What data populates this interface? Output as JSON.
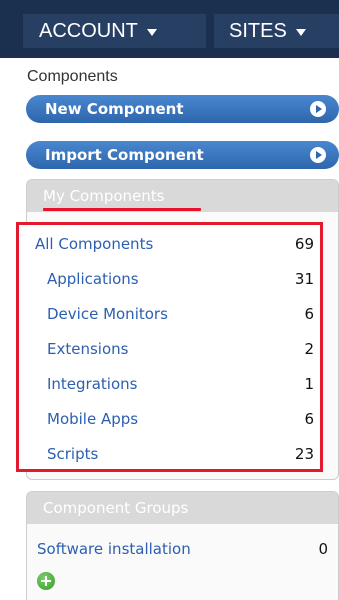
{
  "nav": {
    "account": "ACCOUNT",
    "sites": "SITES"
  },
  "components": {
    "section_title": "Components",
    "new_button": "New Component",
    "import_button": "Import Component"
  },
  "my_components": {
    "header": "My Components",
    "items": [
      {
        "label": "All Components",
        "count": "69"
      },
      {
        "label": "Applications",
        "count": "31"
      },
      {
        "label": "Device Monitors",
        "count": "6"
      },
      {
        "label": "Extensions",
        "count": "2"
      },
      {
        "label": "Integrations",
        "count": "1"
      },
      {
        "label": "Mobile Apps",
        "count": "6"
      },
      {
        "label": "Scripts",
        "count": "23"
      }
    ]
  },
  "component_groups": {
    "header": "Component Groups",
    "items": [
      {
        "label": "Software installation",
        "count": "0"
      }
    ]
  },
  "colors": {
    "nav_bg": "#1b2f4e",
    "button_blue": "#3a76c0",
    "highlight_red": "#e11a2f",
    "link_blue": "#2c5fb0"
  },
  "icons": {
    "dropdown": "chevron-down-icon",
    "arrow": "arrow-right-circle-icon",
    "add": "plus-circle-icon"
  }
}
